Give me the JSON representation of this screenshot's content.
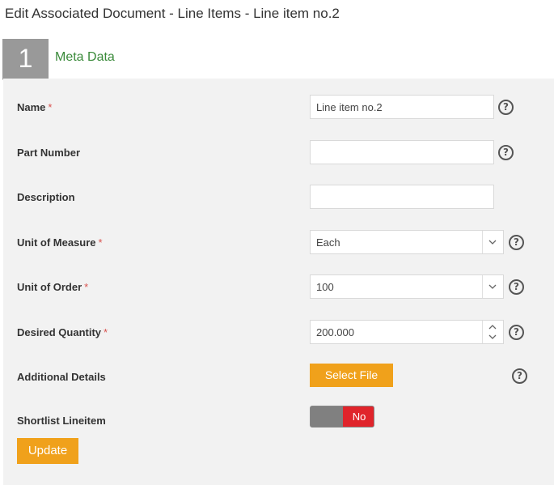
{
  "page_title": "Edit Associated Document - Line Items - Line item no.2",
  "step": {
    "number": "1",
    "label": "Meta Data"
  },
  "form": {
    "name": {
      "label": "Name",
      "required": "*",
      "value": "Line item no.2"
    },
    "part_number": {
      "label": "Part Number",
      "value": ""
    },
    "description": {
      "label": "Description",
      "value": ""
    },
    "unit_of_measure": {
      "label": "Unit of Measure",
      "required": "*",
      "value": "Each"
    },
    "unit_of_order": {
      "label": "Unit of Order",
      "required": "*",
      "value": "100"
    },
    "desired_quantity": {
      "label": "Desired Quantity",
      "required": "*",
      "value": "200.000"
    },
    "additional_details": {
      "label": "Additional Details",
      "button_label": "Select File"
    },
    "shortlist": {
      "label": "Shortlist Lineitem",
      "toggle_label": "No"
    },
    "help_glyph": "?",
    "update_label": "Update"
  },
  "colors": {
    "accent_orange": "#f0a11b",
    "toggle_red": "#e0242b",
    "step_green": "#3a8a3a",
    "required_red": "#d9534f"
  },
  "icons": {
    "help": "question-circle-icon",
    "dropdown": "chevron-down-icon",
    "spinner": "chevron-up-down-icon"
  }
}
